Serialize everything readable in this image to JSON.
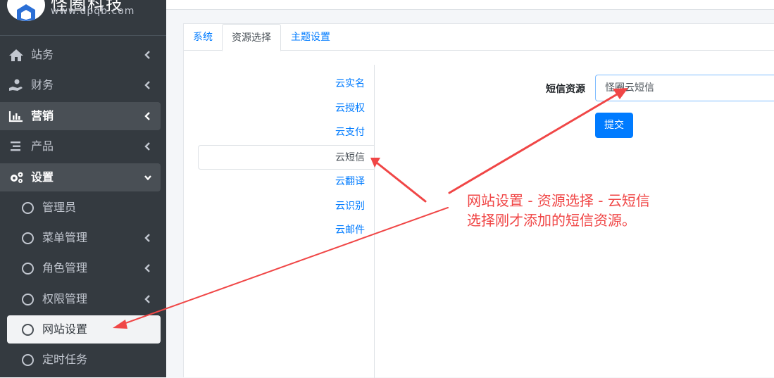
{
  "brand": {
    "name": "怪圈科技",
    "url": "www.dpqb.com"
  },
  "sidebar": {
    "items": [
      {
        "label": "站务",
        "icon": "home-icon"
      },
      {
        "label": "财务",
        "icon": "hand-coin-icon"
      },
      {
        "label": "营销",
        "icon": "bar-chart-icon"
      },
      {
        "label": "产品",
        "icon": "list-icon"
      },
      {
        "label": "设置",
        "icon": "cogs-icon"
      }
    ],
    "sub_items": [
      {
        "label": "管理员"
      },
      {
        "label": "菜单管理"
      },
      {
        "label": "角色管理"
      },
      {
        "label": "权限管理"
      },
      {
        "label": "网站设置"
      },
      {
        "label": "定时任务"
      }
    ]
  },
  "tabs": [
    {
      "label": "系统"
    },
    {
      "label": "资源选择"
    },
    {
      "label": "主题设置"
    }
  ],
  "resource_menu": [
    {
      "label": "云实名"
    },
    {
      "label": "云授权"
    },
    {
      "label": "云支付"
    },
    {
      "label": "云短信"
    },
    {
      "label": "云翻译"
    },
    {
      "label": "云识别"
    },
    {
      "label": "云邮件"
    }
  ],
  "form": {
    "label": "短信资源",
    "selected": "怪圈云短信",
    "submit_label": "提交"
  },
  "annotation": {
    "line1": "网站设置 - 资源选择 - 云短信",
    "line2": "选择刚才添加的短信资源。"
  },
  "colors": {
    "sidebar_bg": "#343a40",
    "link": "#007bff",
    "primary_button": "#007bff",
    "annotation": "#f04646"
  }
}
